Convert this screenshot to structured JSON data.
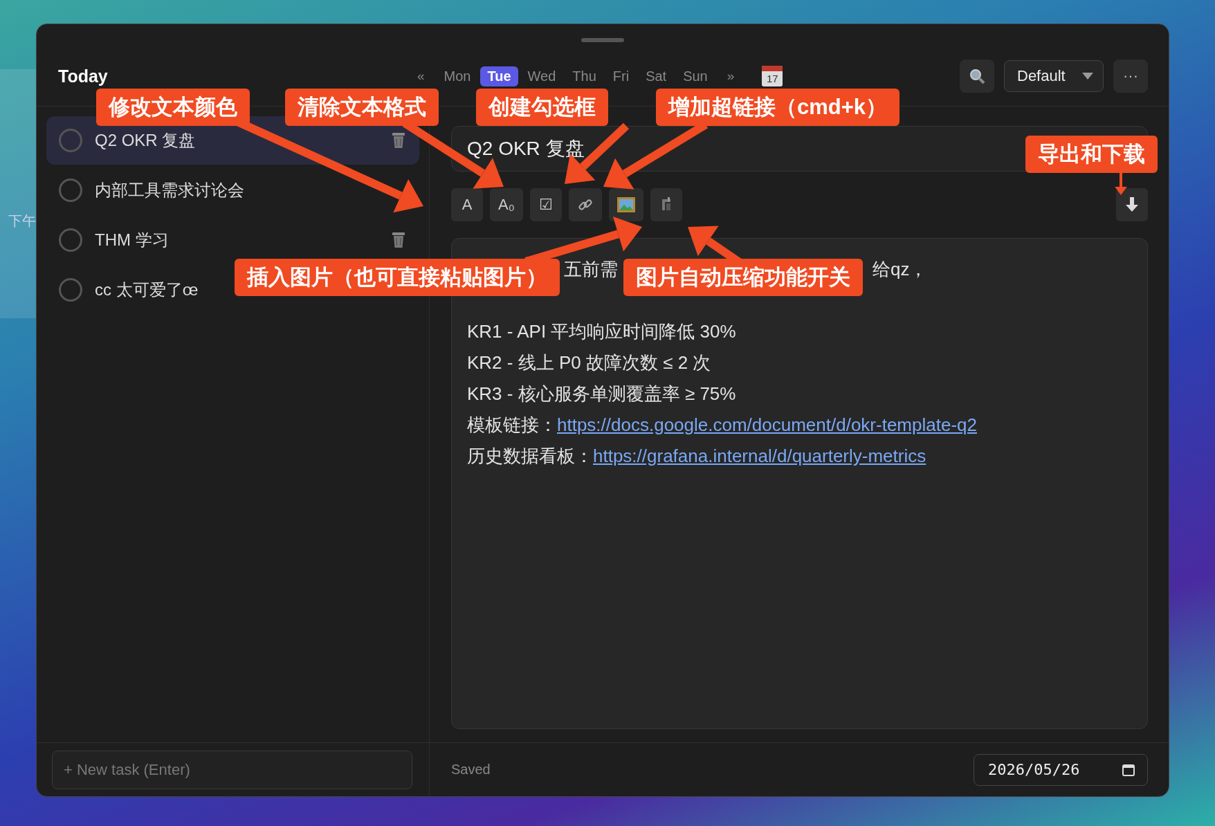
{
  "desktop_widget": {
    "text": "下午"
  },
  "header": {
    "title": "Today",
    "prev": "«",
    "next": "»",
    "days": [
      {
        "label": "Mon",
        "selected": false
      },
      {
        "label": "Tue",
        "selected": true
      },
      {
        "label": "Wed",
        "selected": false
      },
      {
        "label": "Thu",
        "selected": false
      },
      {
        "label": "Fri",
        "selected": false
      },
      {
        "label": "Sat",
        "selected": false
      },
      {
        "label": "Sun",
        "selected": false
      }
    ],
    "calendar_day": "17",
    "view": "Default",
    "more": "···"
  },
  "tasks": [
    {
      "title": "Q2 OKR 复盘",
      "selected": true,
      "show_delete": true
    },
    {
      "title": "内部工具需求讨论会",
      "selected": false,
      "show_delete": false
    },
    {
      "title": "THM 学习",
      "selected": false,
      "show_delete": true
    },
    {
      "title": "cc 太可爱了œ",
      "selected": false,
      "show_delete": false
    }
  ],
  "new_task": {
    "placeholder": "+ New task (Enter)"
  },
  "editor": {
    "title": "Q2 OKR 复盘",
    "toolbar": [
      "A",
      "A₀",
      "☑"
    ],
    "partial_line": [
      "五前需",
      "给qz，"
    ],
    "lines": [
      {
        "kind": "text",
        "text": "KR1 - API 平均响应时间降低 30%"
      },
      {
        "kind": "text",
        "text": "KR2 - 线上 P0 故障次数 ≤ 2 次"
      },
      {
        "kind": "text",
        "text": "KR3 - 核心服务单测覆盖率 ≥ 75%"
      },
      {
        "kind": "link",
        "label": "模板链接：",
        "url": "https://docs.google.com/document/d/okr-template-q2 "
      },
      {
        "kind": "link",
        "label": "历史数据看板：",
        "url": "https://grafana.internal/d/quarterly-metrics"
      }
    ]
  },
  "status": "Saved",
  "date": "2026/05/26",
  "annotations": [
    "修改文本颜色",
    "清除文本格式",
    "创建勾选框",
    "增加超链接（cmd+k）",
    "导出和下载",
    "插入图片（也可直接粘贴图片）",
    "图片自动压缩功能开关"
  ]
}
